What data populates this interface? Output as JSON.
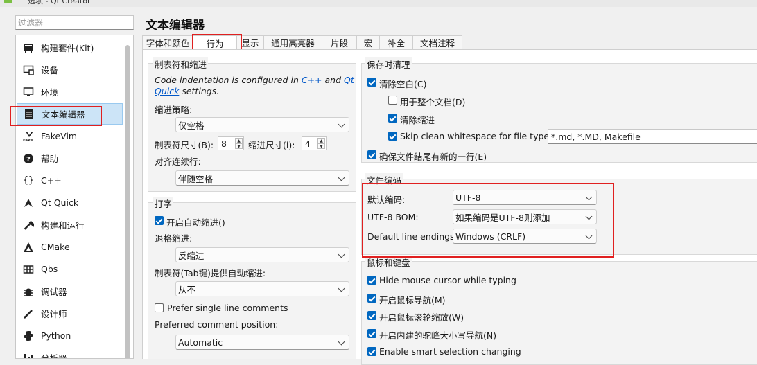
{
  "window": {
    "title": "选项 - Qt Creator"
  },
  "filter": {
    "placeholder": "过滤器"
  },
  "sidebar": {
    "items": [
      {
        "label": "构建套件(Kit)",
        "icon": "kit-icon"
      },
      {
        "label": "设备",
        "icon": "device-icon"
      },
      {
        "label": "环境",
        "icon": "monitor-icon"
      },
      {
        "label": "文本编辑器",
        "icon": "text-editor-icon",
        "selected": true
      },
      {
        "label": "FakeVim",
        "icon": "fakevim-icon"
      },
      {
        "label": "帮助",
        "icon": "help-icon"
      },
      {
        "label": "C++",
        "icon": "braces-icon"
      },
      {
        "label": "Qt Quick",
        "icon": "qtquick-icon"
      },
      {
        "label": "构建和运行",
        "icon": "hammer-icon"
      },
      {
        "label": "CMake",
        "icon": "cmake-icon"
      },
      {
        "label": "Qbs",
        "icon": "qbs-icon"
      },
      {
        "label": "调试器",
        "icon": "bug-icon"
      },
      {
        "label": "设计师",
        "icon": "pen-icon"
      },
      {
        "label": "Python",
        "icon": "python-icon"
      },
      {
        "label": "分析器",
        "icon": "analyzer-icon"
      }
    ]
  },
  "page": {
    "title": "文本编辑器"
  },
  "tabs": [
    "字体和颜色",
    "行为",
    "显示",
    "通用高亮器",
    "片段",
    "宏",
    "补全",
    "文档注释"
  ],
  "tabs_active": "行为",
  "tabs_behavior": {
    "indent_group": {
      "title": "制表符和缩进",
      "note_prefix": "Code indentation is configured in ",
      "note_link1": "C++",
      "note_and": " and ",
      "note_link2a": "Qt",
      "note_link2b": "Quick",
      "note_suffix": " settings.",
      "policy_label": "缩进策略:",
      "policy_value": "仅空格",
      "tab_size_label": "制表符尺寸(B):",
      "tab_size_value": "8",
      "indent_size_label": "缩进尺寸(i):",
      "indent_size_value": "4",
      "align_label": "对齐连续行:",
      "align_value": "伴随空格"
    },
    "typing_group": {
      "title": "打字",
      "auto_indent_label": "开启自动缩进()",
      "auto_indent_checked": true,
      "backspace_label": "退格缩进:",
      "backspace_value": "反缩进",
      "tab_key_label": "制表符(Tab键)提供自动缩进:",
      "tab_key_value": "从不",
      "prefer_single_label": "Prefer single line comments",
      "prefer_single_checked": false,
      "comment_pos_label": "Preferred comment position:",
      "comment_pos_value": "Automatic"
    },
    "save_group": {
      "title": "保存时清理",
      "clean_whitespace": "清除空白(C)",
      "clean_whitespace_checked": true,
      "entire_doc": "用于整个文档(D)",
      "entire_doc_checked": false,
      "clean_indent": "清除缩进",
      "clean_indent_checked": true,
      "skip_label": "Skip clean whitespace for file types:",
      "skip_checked": true,
      "skip_value": "*.md, *.MD, Makefile",
      "newline_label": "确保文件结尾有新的一行(E)",
      "newline_checked": true
    },
    "encoding_group": {
      "title": "文件编码",
      "default_label": "默认编码:",
      "default_value": "UTF-8",
      "bom_label": "UTF-8 BOM:",
      "bom_value": "如果编码是UTF-8则添加",
      "endings_label": "Default line endings:",
      "endings_value": "Windows (CRLF)"
    },
    "mouse_group": {
      "title": "鼠标和键盘",
      "items": [
        {
          "label": "Hide mouse cursor while typing",
          "checked": true
        },
        {
          "label": "开启鼠标导航(M)",
          "checked": true
        },
        {
          "label": "开启鼠标滚轮缩放(W)",
          "checked": true
        },
        {
          "label": "开启内建的驼峰大小写导航(N)",
          "checked": true
        },
        {
          "label": "Enable smart selection changing",
          "checked": true
        }
      ]
    }
  },
  "colors": {
    "accent": "#0067c0",
    "selection": "#cce4f7",
    "highlight_box": "#e02020"
  }
}
